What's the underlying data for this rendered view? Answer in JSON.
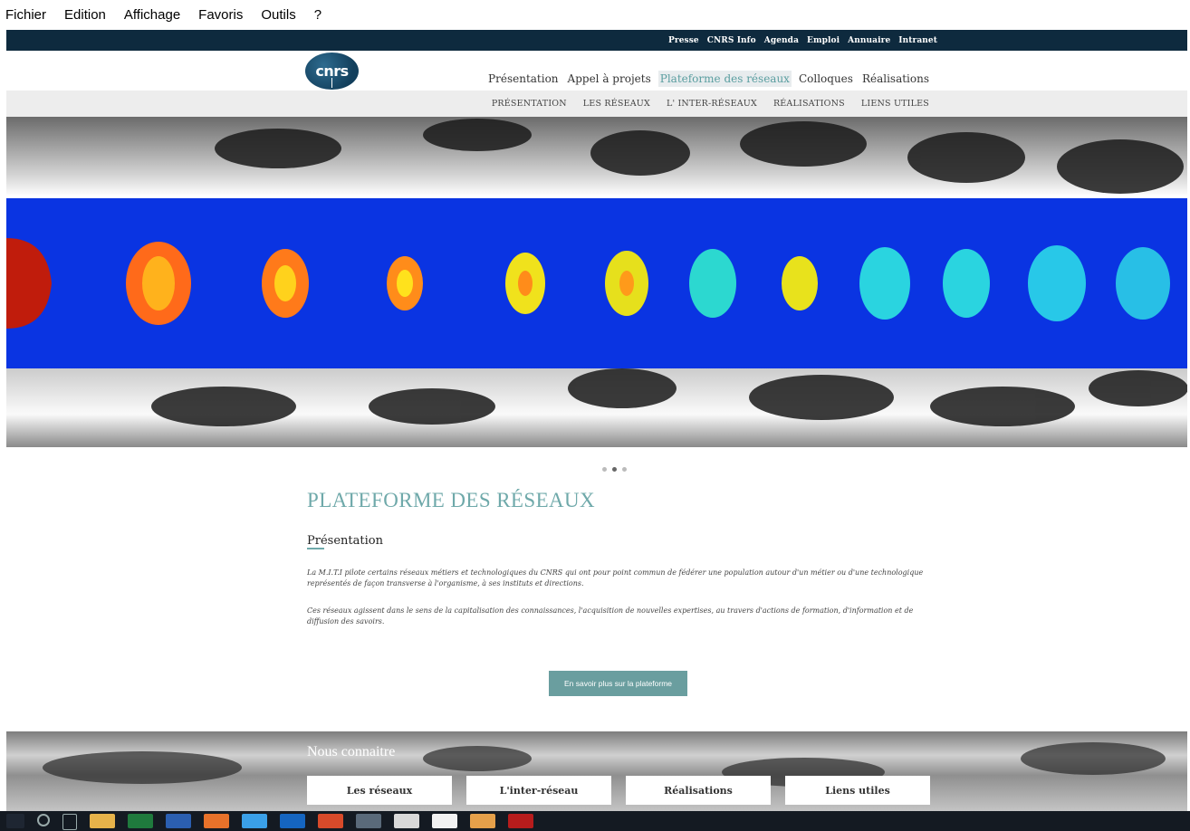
{
  "menubar": [
    "Fichier",
    "Edition",
    "Affichage",
    "Favoris",
    "Outils",
    "?"
  ],
  "toplinks": [
    "Presse",
    "CNRS Info",
    "Agenda",
    "Emploi",
    "Annuaire",
    "Intranet"
  ],
  "logo": {
    "text": "cnrs"
  },
  "mainnav": [
    {
      "label": "Présentation",
      "active": false
    },
    {
      "label": "Appel à projets",
      "active": false
    },
    {
      "label": "Plateforme des réseaux",
      "active": true
    },
    {
      "label": "Colloques",
      "active": false
    },
    {
      "label": "Réalisations",
      "active": false
    }
  ],
  "subnav": [
    "PRÉSENTATION",
    "LES RÉSEAUX",
    "L' INTER-RÉSEAUX",
    "RÉALISATIONS",
    "LIENS UTILES"
  ],
  "slider": {
    "count": 3,
    "active_index": 1
  },
  "content": {
    "title": "PLATEFORME DES RÉSEAUX",
    "section": "Présentation",
    "paragraph1": "La M.I.T.I pilote certains réseaux métiers et technologiques du CNRS qui ont pour point commun de fédérer une population autour d'un métier ou d'une technologique représentés de façon transverse à l'organisme, à ses instituts et directions.",
    "paragraph2": "Ces réseaux agissent dans le sens de la capitalisation des connaissances, l'acquisition de nouvelles expertises, au travers d'actions de formation, d'information et de diffusion des savoirs.",
    "cta": "En savoir plus sur la plateforme"
  },
  "footer": {
    "title": "Nous connaitre",
    "buttons": [
      "Les réseaux",
      "L'inter-réseau",
      "Réalisations",
      "Liens utiles"
    ]
  },
  "colors": {
    "topbar": "#0e2a3e",
    "accent": "#6fa9aa",
    "cta": "#6a9e9f",
    "taskbar": "#141a22"
  },
  "taskbar_icons": [
    "windows-start-icon",
    "search-icon",
    "task-view-icon",
    "file-explorer-icon",
    "excel-icon",
    "word-icon",
    "firefox-icon",
    "internet-explorer-icon",
    "outlook-icon",
    "powerpoint-icon",
    "network-icon",
    "chrome-icon",
    "notepad-icon",
    "paint-icon",
    "acrobat-icon"
  ]
}
